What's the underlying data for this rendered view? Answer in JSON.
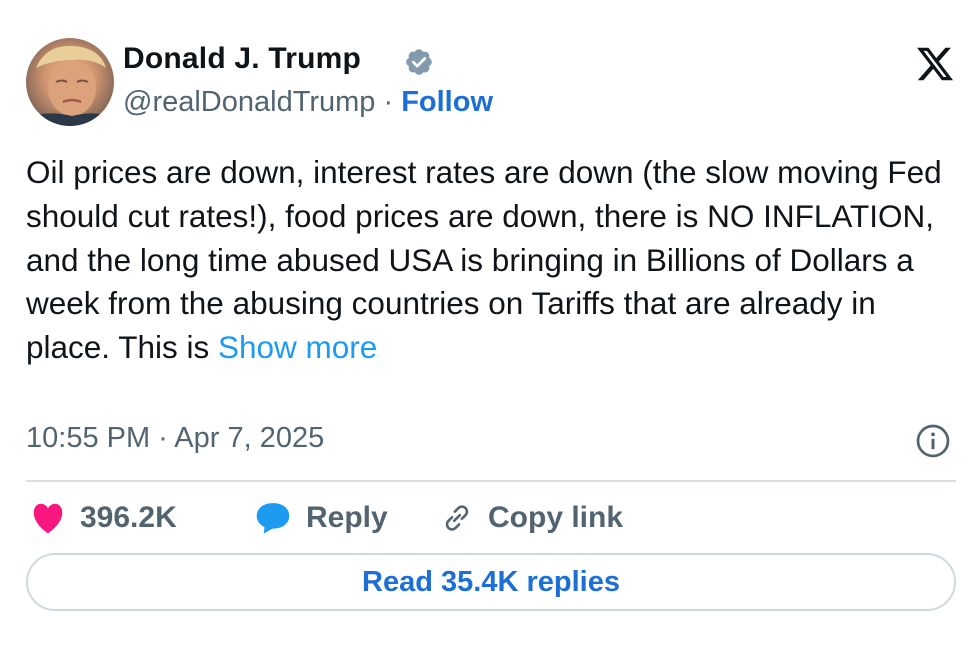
{
  "author": {
    "name": "Donald J. Trump",
    "handle": "@realDonaldTrump",
    "separator": " · ",
    "follow_label": "Follow"
  },
  "tweet": {
    "text": "Oil prices are down, interest rates are down (the slow moving Fed should cut rates!), food prices are down, there is NO INFLATION, and the long time abused USA is bringing in Billions of Dollars a week from the abusing countries on Tariffs that are already in place. This is ",
    "show_more_label": "Show more",
    "timestamp": "10:55 PM · Apr 7, 2025"
  },
  "actions": {
    "likes_count": "396.2K",
    "reply_label": "Reply",
    "copy_link_label": "Copy link",
    "read_replies_label": "Read 35.4K replies"
  },
  "icons": {
    "verified": "verified-badge-icon",
    "logo": "x-logo-icon",
    "info": "info-icon",
    "like": "heart-icon",
    "reply": "speech-bubble-icon",
    "copy_link": "link-icon"
  },
  "colors": {
    "heart": "#f91880",
    "reply_bubble": "#1d9bf0",
    "link_blue": "#1d9bf0",
    "follow_blue": "#1d6fd6",
    "verified_gray": "#829aab",
    "text": "#0f1419",
    "muted": "#536471"
  }
}
